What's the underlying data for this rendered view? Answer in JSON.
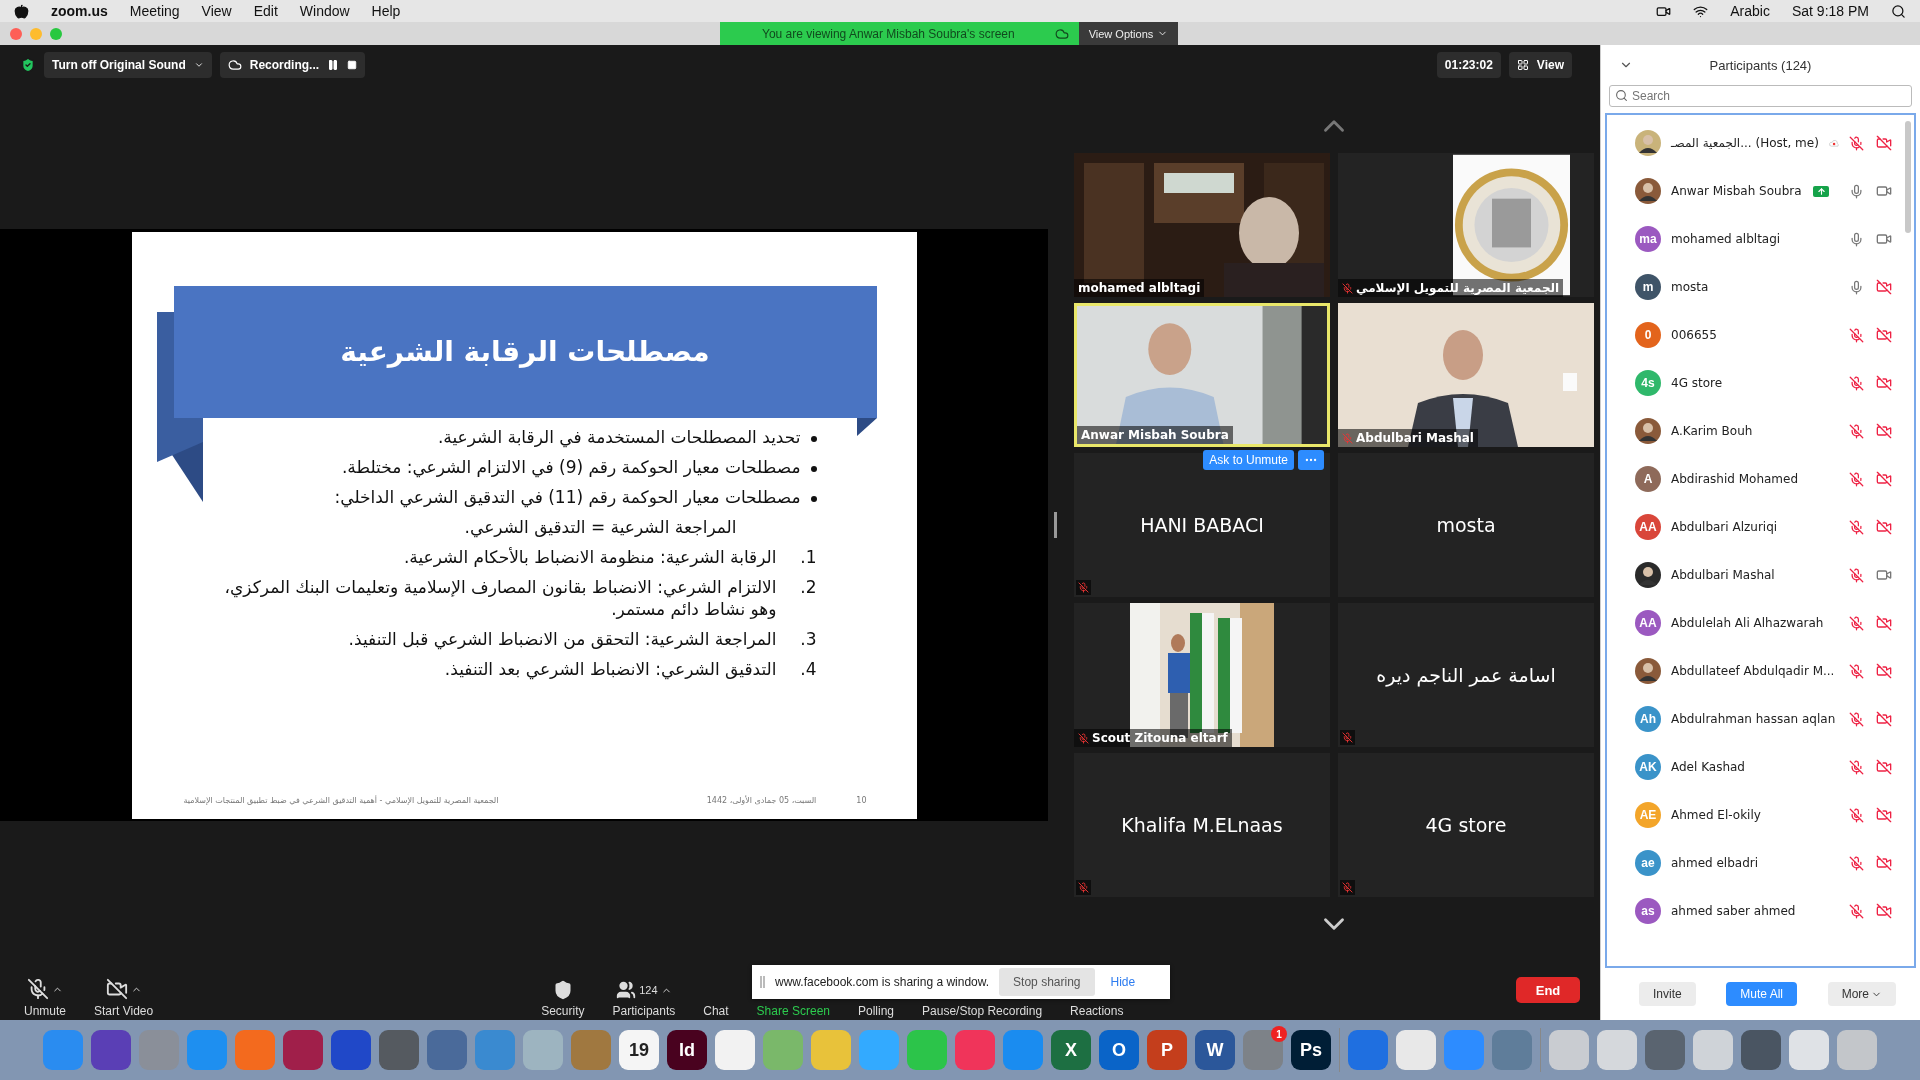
{
  "menubar": {
    "app": "zoom.us",
    "menus": [
      "Meeting",
      "View",
      "Edit",
      "Window",
      "Help"
    ],
    "input": "Arabic",
    "clock": "Sat 9:18 PM"
  },
  "titlebar": {
    "banner": "You are viewing Anwar Misbah Soubra's screen",
    "options": "View Options"
  },
  "topbar": {
    "sound": "Turn off Original Sound",
    "recording": "Recording...",
    "timer": "01:23:02",
    "view": "View"
  },
  "slide": {
    "title": "مصطلحات الرقابة الشرعية",
    "items": [
      {
        "kind": "bullet",
        "text": "تحديد المصطلحات المستخدمة في الرقابة الشرعية."
      },
      {
        "kind": "bullet",
        "text": "مصطلحات معيار الحوكمة رقم (9) في الالتزام الشرعي: مختلطة."
      },
      {
        "kind": "bullet",
        "text": "مصطلحات معيار الحوكمة رقم (11) في التدقيق الشرعي الداخلي:"
      },
      {
        "kind": "plain",
        "text": "المراجعة الشرعية = التدقيق الشرعي."
      },
      {
        "kind": "numbered",
        "number": "1.",
        "text": "الرقابة الشرعية: منظومة الانضباط بالأحكام الشرعية."
      },
      {
        "kind": "numbered",
        "number": "2.",
        "text": "الالتزام الشرعي: الانضباط بقانون المصارف الإسلامية وتعليمات البنك المركزي، وهو نشاط دائم مستمر."
      },
      {
        "kind": "numbered",
        "number": "3.",
        "text": "المراجعة الشرعية: التحقق من الانضباط الشرعي قبل التنفيذ."
      },
      {
        "kind": "numbered",
        "number": "4.",
        "text": "التدقيق الشرعي: الانضباط الشرعي بعد التنفيذ."
      }
    ],
    "footer": "الجمعية المصرية للتمويل الإسلامي - أهمية التدقيق الشرعي في ضبط تطبيق المنتجات الإسلامية",
    "date": "السبت، 05 جمادى الأولى، 1442",
    "page": "10"
  },
  "tiles": [
    {
      "name": "mohamed albltagi",
      "kind": "video",
      "muted": false,
      "speaking": false
    },
    {
      "name": "الجمعية المصرية للتمويل الإسلامي",
      "muted": true,
      "speaking": false
    },
    {
      "name": "Anwar Misbah Soubra",
      "kind": "video",
      "muted": false,
      "speaking": true
    },
    {
      "name": "Abdulbari Mashal",
      "kind": "video",
      "muted": true,
      "speaking": false
    },
    {
      "name": "HANI BABACI",
      "kind": "name",
      "muted": true,
      "speaking": false,
      "hover_button": "Ask to Unmute"
    },
    {
      "name": "mosta",
      "kind": "name",
      "muted": false,
      "speaking": false
    },
    {
      "name": "Scout Zitouna eltarf",
      "muted": true,
      "speaking": false
    },
    {
      "name": "اسامة عمر الناجم ديره",
      "kind": "name",
      "muted": true,
      "speaking": false
    },
    {
      "name": "Khalifa M.ELnaas",
      "kind": "name",
      "muted": true,
      "speaking": false
    },
    {
      "name": "4G store",
      "kind": "name",
      "muted": true,
      "speaking": false
    }
  ],
  "toolbar": {
    "items": [
      {
        "kind": "mic",
        "label": "Unmute",
        "caret": true
      },
      {
        "kind": "video",
        "label": "Start Video",
        "caret": true
      },
      {
        "kind": "security",
        "label": "Security",
        "caret": false
      },
      {
        "kind": "participants",
        "label": "Participants",
        "count": "124",
        "caret": true
      },
      {
        "kind": "plain",
        "label": "Chat",
        "caret": false
      },
      {
        "kind": "share",
        "label": "Share Screen",
        "caret": false
      },
      {
        "kind": "plain",
        "label": "Polling",
        "caret": false
      },
      {
        "kind": "plain",
        "label": "Pause/Stop Recording",
        "caret": false
      },
      {
        "kind": "plain",
        "label": "Reactions",
        "caret": false
      }
    ],
    "end": "End"
  },
  "share_popup": {
    "message": "www.facebook.com is sharing a window.",
    "stop": "Stop sharing",
    "hide": "Hide"
  },
  "participants": {
    "title": "Participants (124)",
    "search_placeholder": "Search",
    "rows": [
      {
        "name": "الجمعية المصـ... (Host, me)",
        "recording": true,
        "sharing": false,
        "muted": true,
        "video_on": false
      },
      {
        "name": "Anwar Misbah Soubra",
        "recording": false,
        "sharing": true,
        "muted": false,
        "video_on": true
      },
      {
        "name": "mohamed albltagi",
        "kind": "initials",
        "initials": "ma",
        "color": "#9b59c0",
        "recording": false,
        "sharing": false,
        "muted": false,
        "video_on": true
      },
      {
        "name": "mosta",
        "kind": "initials",
        "initials": "m",
        "color": "#3f5468",
        "recording": false,
        "sharing": false,
        "muted": false,
        "video_on": false
      },
      {
        "name": "006655",
        "kind": "initials",
        "initials": "0",
        "color": "#e3641c",
        "recording": false,
        "sharing": false,
        "muted": true,
        "video_on": false
      },
      {
        "name": "4G store",
        "kind": "initials",
        "initials": "4s",
        "color": "#2fb86b",
        "recording": false,
        "sharing": false,
        "muted": true,
        "video_on": false
      },
      {
        "name": "A.Karim Bouh",
        "recording": false,
        "sharing": false,
        "muted": true,
        "video_on": false
      },
      {
        "name": "Abdirashid Mohamed",
        "kind": "initials",
        "initials": "A",
        "color": "#8e6a5a",
        "recording": false,
        "sharing": false,
        "muted": true,
        "video_on": false
      },
      {
        "name": "Abdulbari Alzuriqi",
        "kind": "initials",
        "initials": "AA",
        "color": "#d9463a",
        "recording": false,
        "sharing": false,
        "muted": true,
        "video_on": false
      },
      {
        "name": "Abdulbari Mashal",
        "recording": false,
        "sharing": false,
        "muted": true,
        "video_on": true
      },
      {
        "name": "Abdulelah Ali Alhazwarah",
        "kind": "initials",
        "initials": "AA",
        "color": "#9b59c0",
        "recording": false,
        "sharing": false,
        "muted": true,
        "video_on": false
      },
      {
        "name": "Abdullateef Abdulqadir M...",
        "recording": false,
        "sharing": false,
        "muted": true,
        "video_on": false
      },
      {
        "name": "Abdulrahman hassan aqlan",
        "kind": "initials",
        "initials": "Ah",
        "color": "#3a93c9",
        "recording": false,
        "sharing": false,
        "muted": true,
        "video_on": false
      },
      {
        "name": "Adel Kashad",
        "kind": "initials",
        "initials": "AK",
        "color": "#3a93c9",
        "recording": false,
        "sharing": false,
        "muted": true,
        "video_on": false
      },
      {
        "name": "Ahmed El-okily",
        "kind": "initials",
        "initials": "AE",
        "color": "#f3a52a",
        "recording": false,
        "sharing": false,
        "muted": true,
        "video_on": false
      },
      {
        "name": "ahmed elbadri",
        "kind": "initials",
        "initials": "ae",
        "color": "#3a93c9",
        "recording": false,
        "sharing": false,
        "muted": true,
        "video_on": false
      },
      {
        "name": "ahmed saber ahmed",
        "kind": "initials",
        "initials": "as",
        "color": "#9b59c0",
        "recording": false,
        "sharing": false,
        "muted": true,
        "video_on": false
      }
    ],
    "buttons": {
      "invite": "Invite",
      "mute_all": "Mute All",
      "more": "More"
    }
  },
  "dock": [
    {
      "kind": "app",
      "color": "#2a8cf0"
    },
    {
      "kind": "app",
      "color": "#5a3fb5"
    },
    {
      "kind": "app",
      "color": "#8a8f99"
    },
    {
      "kind": "app",
      "color": "#1e8ff0"
    },
    {
      "kind": "app",
      "color": "#f36a1e"
    },
    {
      "kind": "app",
      "color": "#a01f4a"
    },
    {
      "kind": "app",
      "color": "#2048c8"
    },
    {
      "kind": "app",
      "color": "#555a60"
    },
    {
      "kind": "app",
      "color": "#4a6a9a"
    },
    {
      "kind": "app",
      "color": "#3a8ad0"
    },
    {
      "kind": "app",
      "color": "#9db4c0"
    },
    {
      "kind": "app",
      "color": "#a07840"
    },
    {
      "kind": "app",
      "color": "#f5f5f5",
      "label": "19"
    },
    {
      "kind": "app",
      "color": "#49021f",
      "label": "Id"
    },
    {
      "kind": "app",
      "color": "#f2f2f2"
    },
    {
      "kind": "app",
      "color": "#7ab86a"
    },
    {
      "kind": "app",
      "color": "#e8c23a"
    },
    {
      "kind": "app",
      "color": "#33aaff"
    },
    {
      "kind": "app",
      "color": "#2cc44a"
    },
    {
      "kind": "app",
      "color": "#f0345a"
    },
    {
      "kind": "app",
      "color": "#1a8cf0"
    },
    {
      "kind": "app",
      "color": "#1d6f42",
      "label": "X"
    },
    {
      "kind": "app",
      "color": "#0a64c8",
      "label": "O"
    },
    {
      "kind": "app",
      "color": "#c43e1c",
      "label": "P"
    },
    {
      "kind": "app",
      "color": "#2b579a",
      "label": "W"
    },
    {
      "kind": "app",
      "color": "#7d8288",
      "badge": "1"
    },
    {
      "kind": "app",
      "color": "#001e36",
      "label": "Ps"
    },
    {
      "kind": "divider"
    },
    {
      "kind": "app",
      "color": "#1f6fe0"
    },
    {
      "kind": "app",
      "color": "#e8e8e8"
    },
    {
      "kind": "app",
      "color": "#2d8cff"
    },
    {
      "kind": "app",
      "color": "#5f7d9a"
    },
    {
      "kind": "divider"
    },
    {
      "kind": "app",
      "color": "#c9ccd1"
    },
    {
      "kind": "app",
      "color": "#d5d8dc"
    },
    {
      "kind": "app",
      "color": "#5a6470"
    },
    {
      "kind": "app",
      "color": "#cfd3d8"
    },
    {
      "kind": "app",
      "color": "#4a5562"
    },
    {
      "kind": "app",
      "color": "#dfe2e6"
    },
    {
      "kind": "app",
      "color": "#c3c6ca"
    }
  ]
}
